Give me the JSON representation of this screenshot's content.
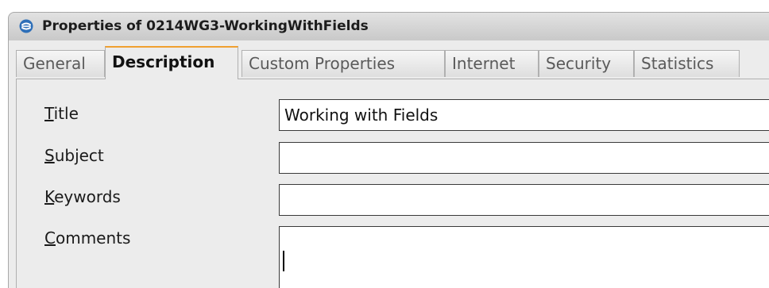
{
  "window": {
    "title": "Properties of 0214WG3-WorkingWithFields"
  },
  "tabs": [
    {
      "label": "General",
      "active": false
    },
    {
      "label": "Description",
      "active": true
    },
    {
      "label": "Custom Properties",
      "active": false
    },
    {
      "label": "Internet",
      "active": false
    },
    {
      "label": "Security",
      "active": false
    },
    {
      "label": "Statistics",
      "active": false
    }
  ],
  "form": {
    "title": {
      "mnemonic": "T",
      "rest": "itle",
      "value": "Working with Fields"
    },
    "subject": {
      "mnemonic": "S",
      "rest": "ubject",
      "value": ""
    },
    "keywords": {
      "mnemonic": "K",
      "rest": "eywords",
      "value": ""
    },
    "comments": {
      "mnemonic": "C",
      "rest": "omments",
      "value": ""
    }
  },
  "colors": {
    "active_tab_accent": "#f0a030",
    "app_icon": "#2e6fb8"
  },
  "icons": {
    "app": "libreoffice-logo-icon"
  }
}
